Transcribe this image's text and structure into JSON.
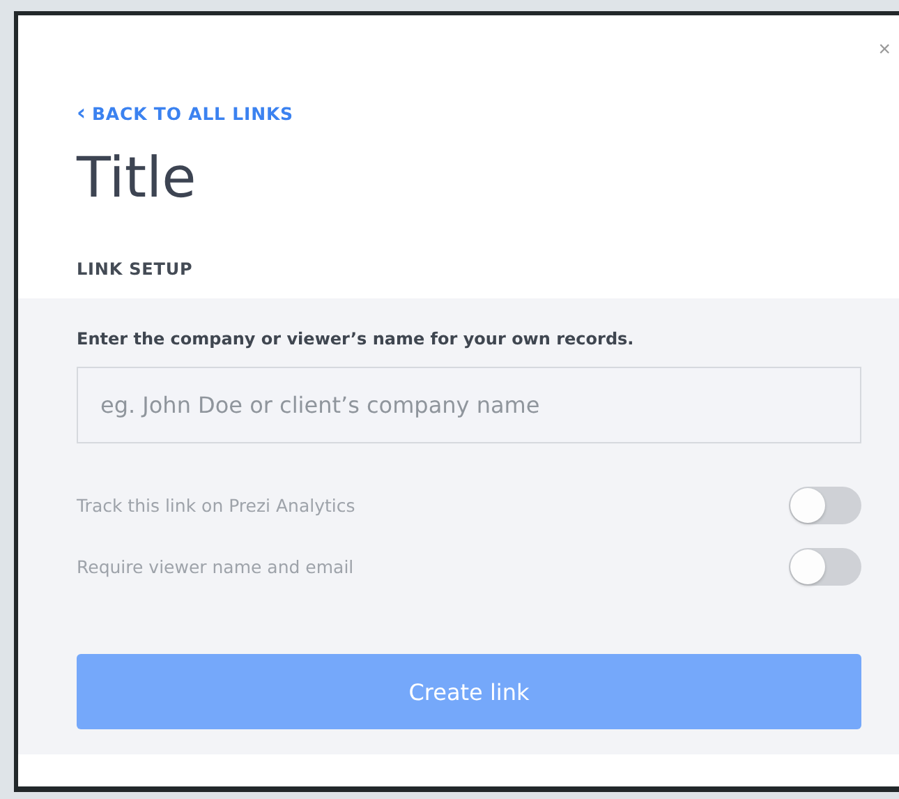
{
  "dialog": {
    "close": "×",
    "back_link": {
      "icon": "‹",
      "label": "BACK TO ALL LINKS"
    },
    "title": "Title",
    "section": "LINK SETUP"
  },
  "form": {
    "label": "Enter the company or viewer’s name for your own records.",
    "placeholder": "eg. John Doe or client’s company name",
    "toggles": [
      {
        "label": "Track this link on Prezi Analytics",
        "on": false,
        "disabled": true
      },
      {
        "label": "Require viewer name and email",
        "on": false,
        "disabled": true
      }
    ],
    "button": {
      "label": "Create link",
      "disabled": true
    }
  }
}
